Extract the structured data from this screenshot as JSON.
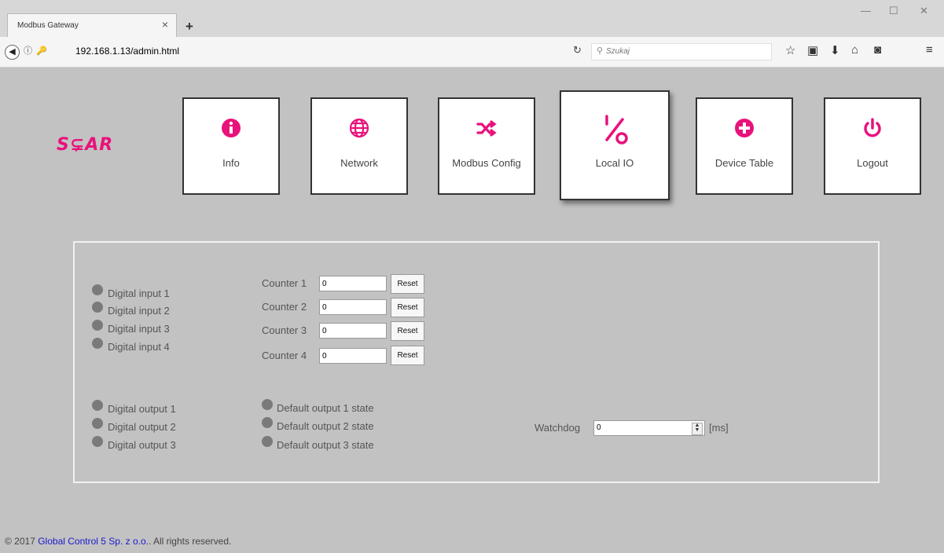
{
  "browser": {
    "tab_title": "Modbus Gateway",
    "tab_close": "×",
    "new_tab": "+",
    "url": "192.168.1.13/admin.html",
    "search_placeholder": "Szukaj",
    "window_controls": [
      "—",
      "☐",
      "✕"
    ]
  },
  "logo": {
    "text": "S⊊AR",
    "color": "#e8127c"
  },
  "nav": {
    "accent": "#e8127c",
    "tiles": [
      {
        "label": "Info",
        "icon": "info-icon",
        "active": false
      },
      {
        "label": "Network",
        "icon": "globe-icon",
        "active": false
      },
      {
        "label": "Modbus Config",
        "icon": "shuffle-icon",
        "active": false
      },
      {
        "label": "Local IO",
        "icon": "percent-icon",
        "active": true
      },
      {
        "label": "Device Table",
        "icon": "plus-circle-icon",
        "active": false
      },
      {
        "label": "Logout",
        "icon": "power-icon",
        "active": false
      }
    ]
  },
  "inputs": {
    "labels": [
      "Digital input 1",
      "Digital input 2",
      "Digital input 3",
      "Digital input 4"
    ]
  },
  "counters": {
    "items": [
      {
        "label": "Counter 1",
        "value": "0",
        "button": "Reset"
      },
      {
        "label": "Counter 2",
        "value": "0",
        "button": "Reset"
      },
      {
        "label": "Counter 3",
        "value": "0",
        "button": "Reset"
      },
      {
        "label": "Counter 4",
        "value": "0",
        "button": "Reset"
      }
    ]
  },
  "outputs": {
    "labels": [
      "Digital output 1",
      "Digital output 2",
      "Digital output 3"
    ]
  },
  "defaults": {
    "labels": [
      "Default output 1 state",
      "Default output 2 state",
      "Default output 3 state"
    ]
  },
  "watchdog": {
    "label": "Watchdog",
    "value": "0",
    "unit": "[ms]"
  },
  "footer": {
    "prefix": "© 2017 ",
    "link": "Global Control 5 Sp. z o.o.",
    "suffix": ". All rights reserved."
  }
}
